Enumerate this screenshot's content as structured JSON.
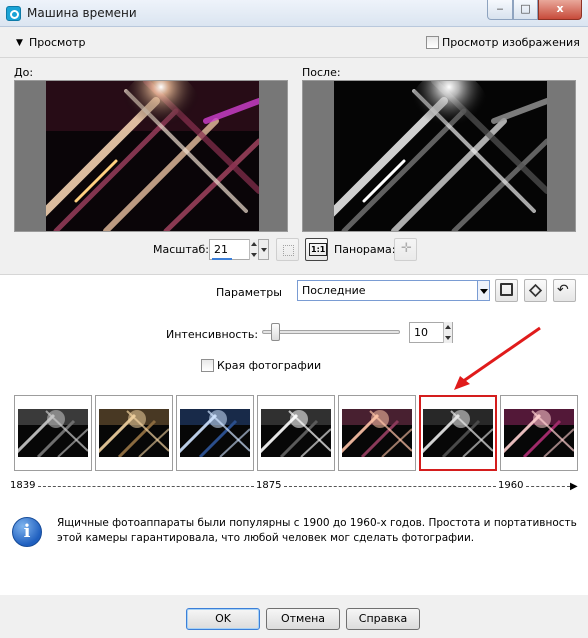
{
  "window": {
    "title": "Машина времени",
    "buttons": {
      "minimize": "‒",
      "maximize": "□",
      "close": "x"
    }
  },
  "preview": {
    "section_label": "Просмотр",
    "image_preview_label": "Просмотр изображения",
    "image_preview_checked": false,
    "before_label": "До:",
    "after_label": "После:"
  },
  "zoom": {
    "label": "Масштаб:",
    "value": "21",
    "one_to_one": "1:1",
    "pan_label": "Панорама:"
  },
  "params": {
    "label": "Параметры",
    "selected": "Последние"
  },
  "intensity": {
    "label": "Интенсивность:",
    "value": "10",
    "level": 0.1
  },
  "edges": {
    "label": "Края фотографии",
    "checked": false
  },
  "thumbnails": [
    {
      "tint": "#6e6e6e",
      "glow": "#c8c8c8",
      "selected": false
    },
    {
      "tint": "#8a6a3f",
      "glow": "#f1d2a0",
      "selected": false
    },
    {
      "tint": "#2a4e8c",
      "glow": "#cfe3ff",
      "selected": false
    },
    {
      "tint": "#5a5a5a",
      "glow": "#ffffff",
      "selected": false
    },
    {
      "tint": "#8a3a5a",
      "glow": "#ffc4a8",
      "selected": false
    },
    {
      "tint": "#4a4a4a",
      "glow": "#e8e8e8",
      "selected": true
    },
    {
      "tint": "#a02a6a",
      "glow": "#ffd0d0",
      "selected": false
    }
  ],
  "timeline": {
    "start": "1839",
    "middle": "1875",
    "end": "1960"
  },
  "info": {
    "text": "Ящичные фотоаппараты были популярны с 1900 до 1960-х годов. Простота и портативность этой камеры гарантировала, что любой человек мог сделать фотографии."
  },
  "buttons": {
    "ok": "OK",
    "cancel": "Отмена",
    "help": "Справка"
  },
  "colors": {
    "accent": "#3c7fd8",
    "selection": "#d41d1d",
    "info_blue": "#1f5fbf"
  }
}
